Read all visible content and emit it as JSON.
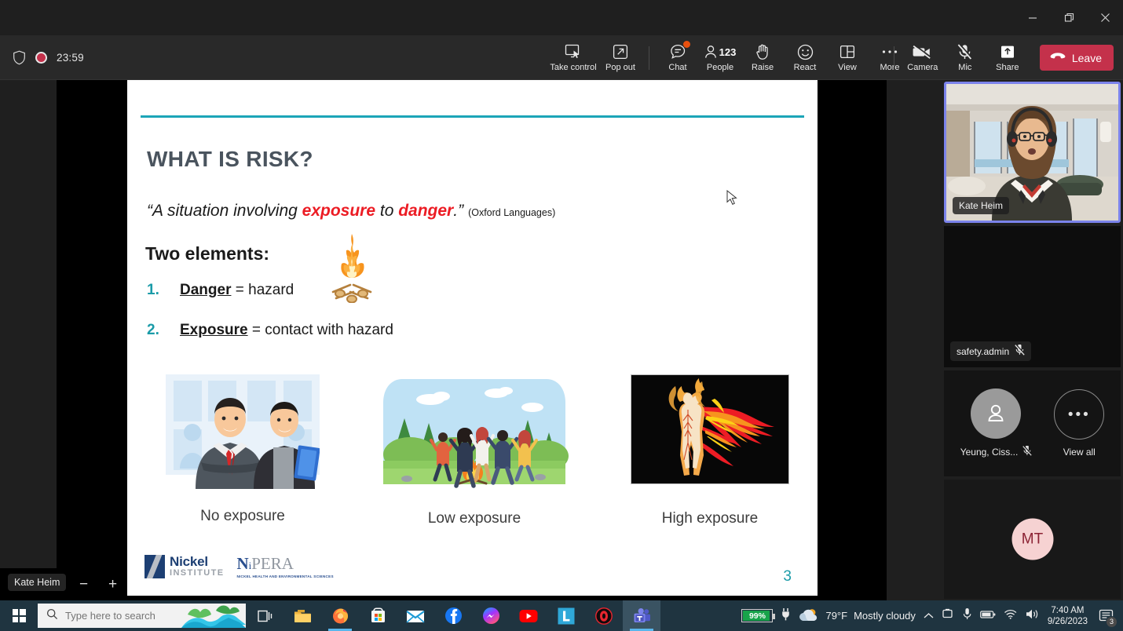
{
  "window": {
    "minimize_label": "Minimize",
    "maximize_label": "Restore",
    "close_label": "Close"
  },
  "toolbar": {
    "recording_time": "23:59",
    "shield_icon": "shield-icon",
    "record_icon": "record-dot-icon",
    "items": [
      {
        "label": "Take control",
        "icon": "take-control-icon"
      },
      {
        "label": "Pop out",
        "icon": "pop-out-icon"
      },
      {
        "label": "Chat",
        "icon": "chat-icon",
        "badge": true
      },
      {
        "label": "People",
        "icon": "people-icon",
        "count": "123"
      },
      {
        "label": "Raise",
        "icon": "raise-hand-icon"
      },
      {
        "label": "React",
        "icon": "react-smiley-icon"
      },
      {
        "label": "View",
        "icon": "view-grid-icon"
      },
      {
        "label": "More",
        "icon": "more-ellipsis-icon"
      }
    ],
    "right_items": [
      {
        "label": "Camera",
        "icon": "camera-off-icon"
      },
      {
        "label": "Mic",
        "icon": "mic-off-icon"
      },
      {
        "label": "Share",
        "icon": "share-up-arrow-icon"
      }
    ],
    "leave_label": "Leave"
  },
  "slide": {
    "title": "WHAT IS RISK?",
    "quote_pre": "“A situation involving ",
    "quote_bold1": "exposure",
    "quote_mid": " to ",
    "quote_bold2": "danger",
    "quote_post": ".”",
    "quote_source": "(Oxford Languages)",
    "two_elements_heading": "Two elements:",
    "list": [
      {
        "num": "1.",
        "term": "Danger",
        "rest": " = hazard"
      },
      {
        "num": "2.",
        "term": "Exposure",
        "rest": " = contact with hazard"
      }
    ],
    "captions": [
      "No exposure",
      "Low  exposure",
      "High exposure"
    ],
    "image_names": [
      "business-people-photo",
      "campfire-group-photo",
      "person-on-fire-photo"
    ],
    "page_number": "3",
    "logo_nickel_line1": "Nickel",
    "logo_nickel_line2": "INSTITUTE",
    "logo_nipera_main": "NiPERA",
    "logo_nipera_sub": "NICKEL HEALTH AND ENVIRONMENTAL SCIENCES"
  },
  "presenter_bar": {
    "name": "Kate Heim",
    "zoom_out": "−",
    "zoom_in": "+"
  },
  "roster": {
    "tiles": [
      {
        "name": "Kate Heim",
        "muted": false,
        "active": true
      },
      {
        "name": "safety.admin",
        "muted": true,
        "active": false
      }
    ],
    "avatars": [
      {
        "label": "Yeung, Ciss...",
        "muted": true,
        "icon": "person-avatar-icon"
      },
      {
        "label": "View all",
        "icon": "more-ellipsis-icon"
      }
    ],
    "initials_tile": "MT"
  },
  "taskbar": {
    "start_icon": "windows-start-icon",
    "search_placeholder": "Type here to search",
    "search_value": "",
    "icons": [
      "task-view-icon",
      "file-explorer-icon",
      "firefox-icon",
      "microsoft-store-icon",
      "mail-icon",
      "facebook-icon",
      "messenger-icon",
      "youtube-icon",
      "lastpass-icon",
      "opera-gx-icon",
      "microsoft-teams-icon"
    ],
    "battery_percent": "99%",
    "plug_icon": "power-plug-icon",
    "weather_temp": "79°F",
    "weather_desc": "Mostly cloudy",
    "tray_icons": [
      "chevron-up-icon",
      "onedrive-icon",
      "microphone-icon",
      "battery-icon",
      "wifi-icon",
      "volume-icon"
    ],
    "time": "7:40 AM",
    "date": "9/26/2023",
    "notification_count": "3"
  },
  "colors": {
    "teal": "#1ca5b8",
    "red": "#ec1c24",
    "leave_red": "#c4314b",
    "active_border": "#7b83eb",
    "taskbar": "#1f3440"
  }
}
